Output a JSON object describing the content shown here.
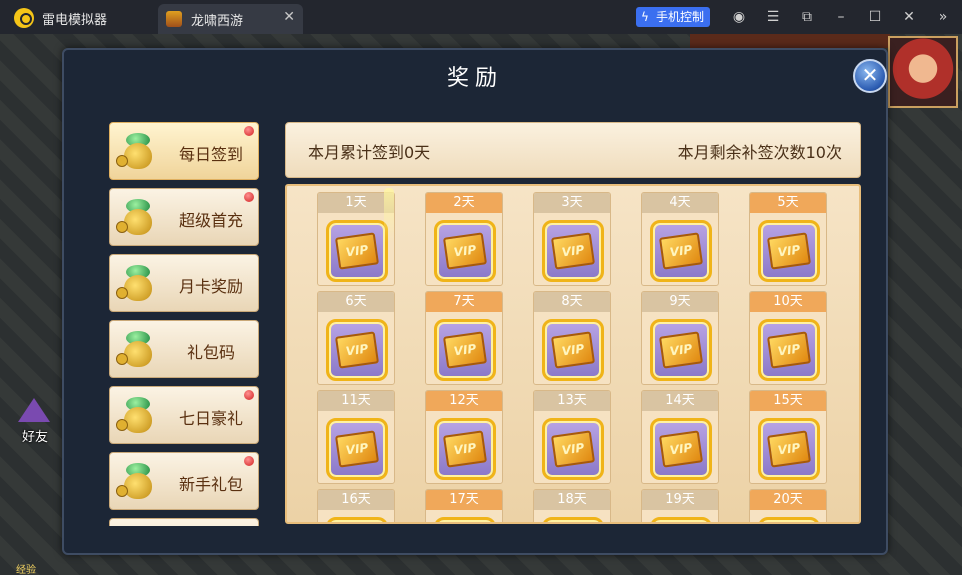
{
  "window": {
    "app_title": "雷电模拟器",
    "tab_label": "龙啸西游",
    "tab_close": "✕",
    "phone_control_label": "手机控制",
    "icons": [
      "account-icon",
      "menu-icon",
      "restore-icon",
      "minimize-icon",
      "maximize-icon",
      "close-icon",
      "collapse-icon"
    ]
  },
  "titlebar_glyphs": {
    "account": "◉",
    "menu": "☰",
    "restore": "⧉",
    "minimize": "–",
    "maximize": "☐",
    "close": "✕",
    "collapse": "»"
  },
  "game": {
    "friend_label": "好友",
    "xp_label": "经验"
  },
  "dialog": {
    "title": "奖励",
    "close_glyph": "✕",
    "menu": [
      {
        "label": "每日签到",
        "active": true,
        "red_dot": true
      },
      {
        "label": "超级首充",
        "active": false,
        "red_dot": true
      },
      {
        "label": "月卡奖励",
        "active": false,
        "red_dot": false
      },
      {
        "label": "礼包码",
        "active": false,
        "red_dot": false
      },
      {
        "label": "七日豪礼",
        "active": false,
        "red_dot": true
      },
      {
        "label": "新手礼包",
        "active": false,
        "red_dot": true
      }
    ],
    "info": {
      "monthly_signin": "本月累计签到0天",
      "remaining_makeup": "本月剩余补签次数10次"
    },
    "days": [
      {
        "label": "1天"
      },
      {
        "label": "2天"
      },
      {
        "label": "3天"
      },
      {
        "label": "4天"
      },
      {
        "label": "5天"
      },
      {
        "label": "6天"
      },
      {
        "label": "7天"
      },
      {
        "label": "8天"
      },
      {
        "label": "9天"
      },
      {
        "label": "10天"
      },
      {
        "label": "11天"
      },
      {
        "label": "12天"
      },
      {
        "label": "13天"
      },
      {
        "label": "14天"
      },
      {
        "label": "15天"
      },
      {
        "label": "16天"
      },
      {
        "label": "17天"
      },
      {
        "label": "18天"
      },
      {
        "label": "19天"
      },
      {
        "label": "20天"
      }
    ],
    "reward_ticket_text": "VIP"
  },
  "colors": {
    "day_header_orange": "#f0a85a",
    "day_header_grey": "#d9c4a2",
    "phone_btn": "#3b6ff0",
    "red_dot": "#d02020"
  }
}
